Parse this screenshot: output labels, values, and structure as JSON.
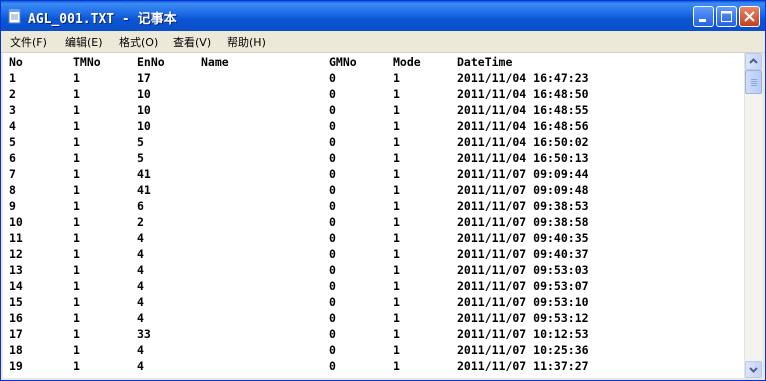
{
  "window": {
    "title": "AGL_001.TXT - 记事本",
    "colors": {
      "titlebar": "#0a5fd8",
      "close_button": "#c4401f",
      "menubar": "#ece9d8"
    }
  },
  "menu": [
    {
      "label": "文件(F)"
    },
    {
      "label": "编辑(E)"
    },
    {
      "label": "格式(O)"
    },
    {
      "label": "查看(V)"
    },
    {
      "label": "帮助(H)"
    }
  ],
  "table": {
    "headers": [
      "No",
      "TMNo",
      "EnNo",
      "Name",
      "GMNo",
      "Mode",
      "DateTime"
    ],
    "rows": [
      [
        "1",
        "1",
        "17",
        "",
        "0",
        "1",
        "2011/11/04 16:47:23"
      ],
      [
        "2",
        "1",
        "10",
        "",
        "0",
        "1",
        "2011/11/04 16:48:50"
      ],
      [
        "3",
        "1",
        "10",
        "",
        "0",
        "1",
        "2011/11/04 16:48:55"
      ],
      [
        "4",
        "1",
        "10",
        "",
        "0",
        "1",
        "2011/11/04 16:48:56"
      ],
      [
        "5",
        "1",
        "5",
        "",
        "0",
        "1",
        "2011/11/04 16:50:02"
      ],
      [
        "6",
        "1",
        "5",
        "",
        "0",
        "1",
        "2011/11/04 16:50:13"
      ],
      [
        "7",
        "1",
        "41",
        "",
        "0",
        "1",
        "2011/11/07 09:09:44"
      ],
      [
        "8",
        "1",
        "41",
        "",
        "0",
        "1",
        "2011/11/07 09:09:48"
      ],
      [
        "9",
        "1",
        "6",
        "",
        "0",
        "1",
        "2011/11/07 09:38:53"
      ],
      [
        "10",
        "1",
        "2",
        "",
        "0",
        "1",
        "2011/11/07 09:38:58"
      ],
      [
        "11",
        "1",
        "4",
        "",
        "0",
        "1",
        "2011/11/07 09:40:35"
      ],
      [
        "12",
        "1",
        "4",
        "",
        "0",
        "1",
        "2011/11/07 09:40:37"
      ],
      [
        "13",
        "1",
        "4",
        "",
        "0",
        "1",
        "2011/11/07 09:53:03"
      ],
      [
        "14",
        "1",
        "4",
        "",
        "0",
        "1",
        "2011/11/07 09:53:07"
      ],
      [
        "15",
        "1",
        "4",
        "",
        "0",
        "1",
        "2011/11/07 09:53:10"
      ],
      [
        "16",
        "1",
        "4",
        "",
        "0",
        "1",
        "2011/11/07 09:53:12"
      ],
      [
        "17",
        "1",
        "33",
        "",
        "0",
        "1",
        "2011/11/07 10:12:53"
      ],
      [
        "18",
        "1",
        "4",
        "",
        "0",
        "1",
        "2011/11/07 10:25:36"
      ],
      [
        "19",
        "1",
        "4",
        "",
        "0",
        "1",
        "2011/11/07 11:37:27"
      ]
    ]
  },
  "icons": {
    "app": "notepad-icon",
    "minimize": "minimize-icon",
    "maximize": "maximize-icon",
    "close": "close-icon",
    "scroll_up": "arrow-up-icon",
    "scroll_down": "arrow-down-icon"
  }
}
